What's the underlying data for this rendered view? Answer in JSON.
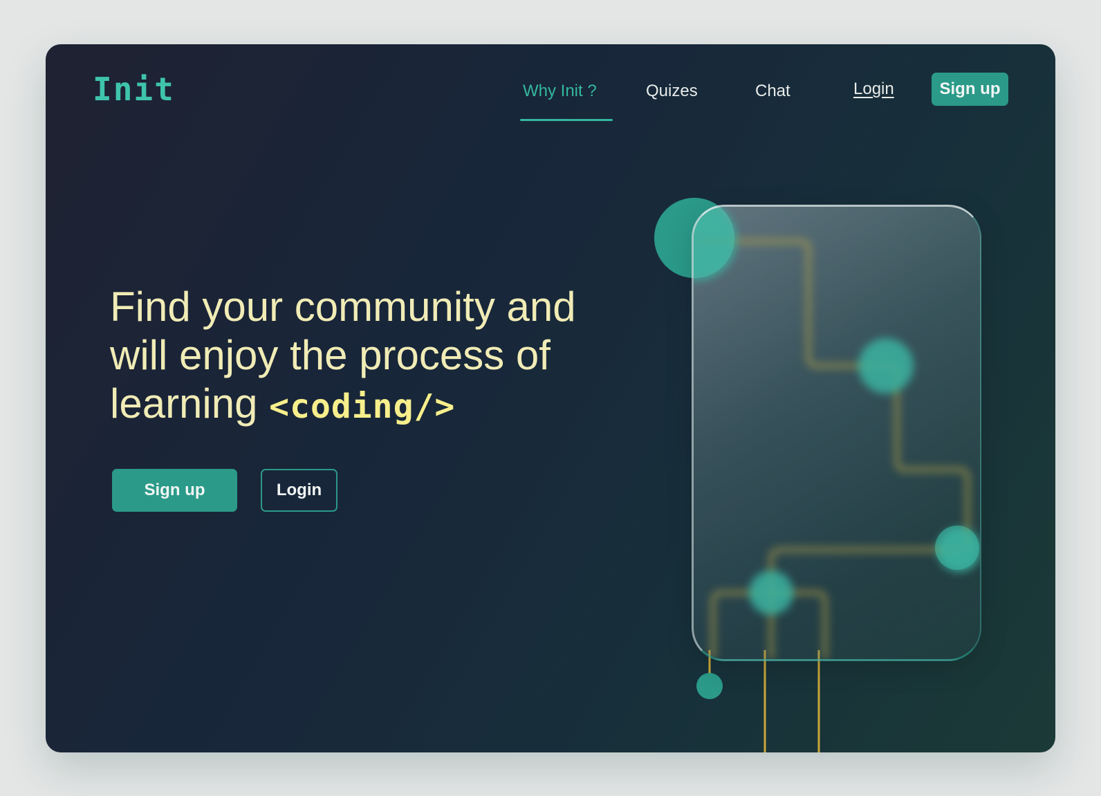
{
  "brand": {
    "logo": "Init",
    "accent_color": "#2b9a89",
    "highlight_color": "#f1ecb6"
  },
  "nav": {
    "items": [
      {
        "label": "Why Init ?",
        "active": true
      },
      {
        "label": "Quizes",
        "active": false
      },
      {
        "label": "Chat",
        "active": false
      }
    ],
    "login_label": "Login",
    "signup_label": "Sign up"
  },
  "hero": {
    "line1": "Find your community and",
    "line2": "will enjoy the process of",
    "line3_prefix": "learning",
    "code_word": "<coding/>"
  },
  "cta": {
    "primary_label": "Sign up",
    "secondary_label": "Login"
  },
  "illustration": {
    "name": "circuit-glass-card",
    "node_color": "#2b9a89",
    "trace_color": "#c9a73a"
  }
}
